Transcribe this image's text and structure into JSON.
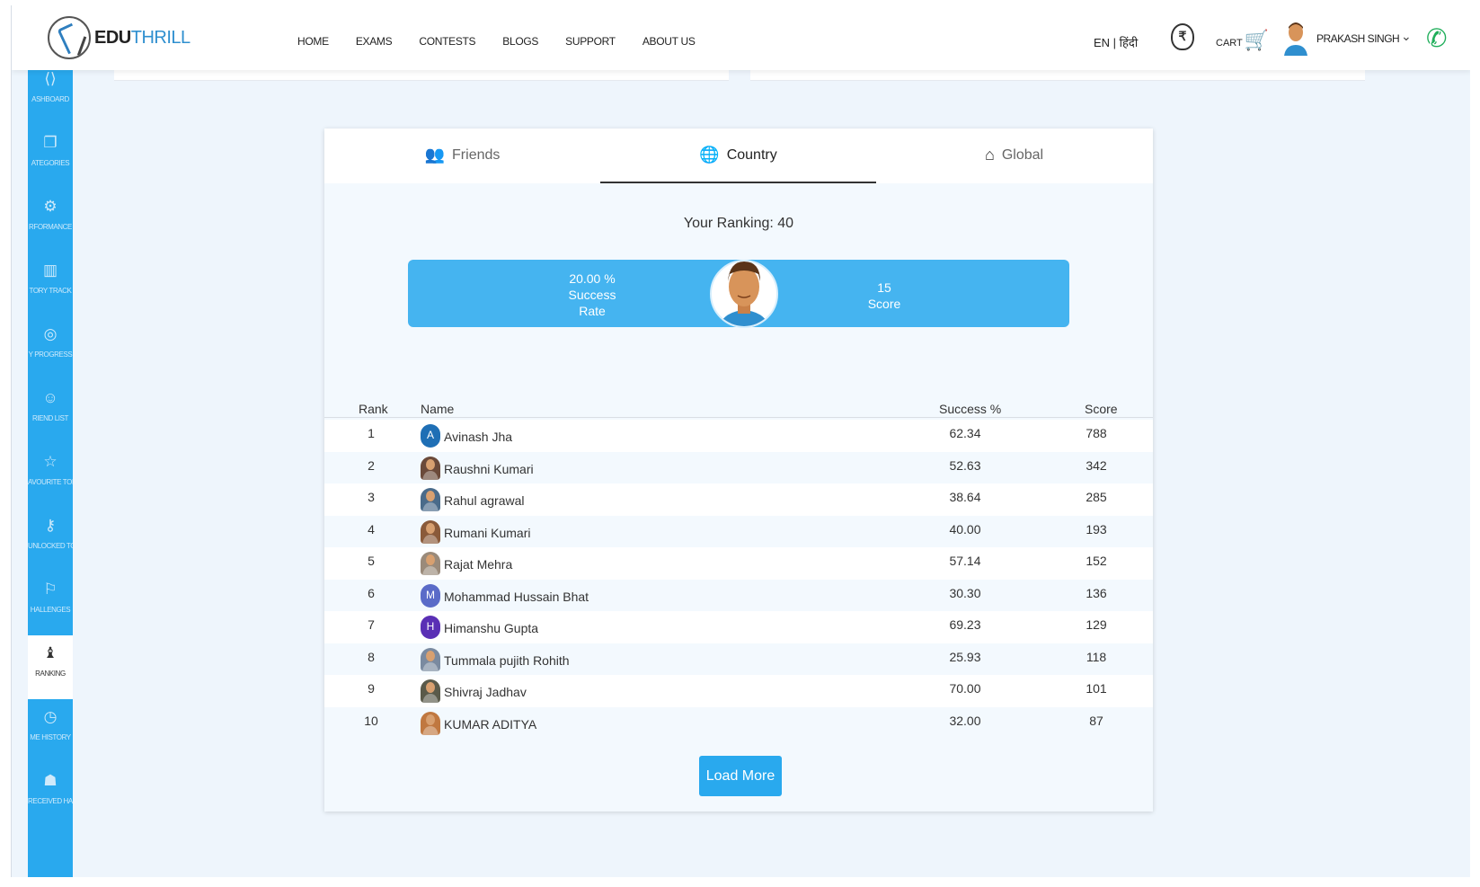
{
  "brand": {
    "name_bold": "EDU",
    "name_light": "THRILL"
  },
  "nav": [
    "HOME",
    "EXAMS",
    "CONTESTS",
    "BLOGS",
    "SUPPORT",
    "ABOUT US"
  ],
  "header": {
    "lang": "EN | हिंदी",
    "coin_icon": "coin-icon",
    "cart_label": "CART",
    "user_name": "PRAKASH SINGH"
  },
  "sidebar": [
    {
      "label": "ASHBOARD",
      "icon": "dashboard-icon",
      "glyph": "⟨⟩"
    },
    {
      "label": "ATEGORIES",
      "icon": "categories-icon",
      "glyph": "❐"
    },
    {
      "label": "RFORMANCE",
      "icon": "performance-icon",
      "glyph": "⚙"
    },
    {
      "label": "TORY TRACK",
      "icon": "chart-icon",
      "glyph": "▥"
    },
    {
      "label": "Y PROGRESS",
      "icon": "progress-icon",
      "glyph": "◎"
    },
    {
      "label": "RIEND LIST",
      "icon": "friends-icon",
      "glyph": "☺"
    },
    {
      "label": "AVOURITE TOPICS",
      "icon": "star-icon",
      "glyph": "☆"
    },
    {
      "label": "UNLOCKED TOPICS",
      "icon": "unlock-icon",
      "glyph": "⚷"
    },
    {
      "label": "HALLENGES",
      "icon": "challenge-icon",
      "glyph": "⚐"
    },
    {
      "label": "RANKING",
      "icon": "ranking-icon",
      "glyph": "♝"
    },
    {
      "label": "ME HISTORY",
      "icon": "history-icon",
      "glyph": "◷"
    },
    {
      "label": "RECEIVED HALLENGES",
      "icon": "received-icon",
      "glyph": "☗"
    }
  ],
  "tabs": [
    {
      "label": "Friends",
      "icon": "friends-icon",
      "glyph": "👥"
    },
    {
      "label": "Country",
      "icon": "globe-icon",
      "glyph": "🌐"
    },
    {
      "label": "Global",
      "icon": "building-icon",
      "glyph": "⌂"
    }
  ],
  "active_tab": "Country",
  "ranking": {
    "your_ranking": "Your Ranking: 40",
    "success_rate_value": "20.00 %",
    "success_rate_label_1": "Success",
    "success_rate_label_2": "Rate",
    "score_value": "15",
    "score_label": "Score"
  },
  "table": {
    "headers": {
      "rank": "Rank",
      "name": "Name",
      "success": "Success %",
      "score": "Score"
    },
    "rows": [
      {
        "rank": "1",
        "name": "Avinash Jha",
        "success": "62.34",
        "score": "788",
        "avatar": "A",
        "color": "#1f6fb5"
      },
      {
        "rank": "2",
        "name": "Raushni Kumari",
        "success": "52.63",
        "score": "342",
        "avatar": "",
        "color": "#6b4a3a"
      },
      {
        "rank": "3",
        "name": "Rahul agrawal",
        "success": "38.64",
        "score": "285",
        "avatar": "",
        "color": "#4a6b8a"
      },
      {
        "rank": "4",
        "name": "Rumani Kumari",
        "success": "40.00",
        "score": "193",
        "avatar": "",
        "color": "#8a5a3a"
      },
      {
        "rank": "5",
        "name": "Rajat Mehra",
        "success": "57.14",
        "score": "152",
        "avatar": "",
        "color": "#9a8a7a"
      },
      {
        "rank": "6",
        "name": "Mohammad Hussain Bhat",
        "success": "30.30",
        "score": "136",
        "avatar": "M",
        "color": "#5a6bc8"
      },
      {
        "rank": "7",
        "name": "Himanshu Gupta",
        "success": "69.23",
        "score": "129",
        "avatar": "H",
        "color": "#5a2fb5"
      },
      {
        "rank": "8",
        "name": "Tummala pujith Rohith",
        "success": "25.93",
        "score": "118",
        "avatar": "",
        "color": "#7a8aa0"
      },
      {
        "rank": "9",
        "name": "Shivraj Jadhav",
        "success": "70.00",
        "score": "101",
        "avatar": "",
        "color": "#5a5a4a"
      },
      {
        "rank": "10",
        "name": "KUMAR ADITYA",
        "success": "32.00",
        "score": "87",
        "avatar": "",
        "color": "#c07840"
      }
    ]
  },
  "load_more": "Load More",
  "colors": {
    "accent": "#29a9ee",
    "statbar": "#45b4f0",
    "call": "#1fae5a"
  }
}
